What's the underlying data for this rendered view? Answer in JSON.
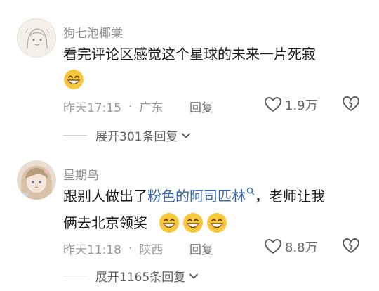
{
  "comments": [
    {
      "username": "狗七泡椰棠",
      "text": "看完评论区感觉这个星球的未来一片死寂",
      "emoji_count": 1,
      "time": "昨天17:15",
      "location": "广东",
      "reply_label": "回复",
      "likes": "1.9万",
      "expand_label": "展开301条回复"
    },
    {
      "username": "星期鸟",
      "text_before_link": "跟别人做出了",
      "link_text": "粉色的阿司匹林",
      "text_after_link": "，老师让我",
      "text_line2": "俩去北京领奖",
      "emoji_count": 3,
      "time": "昨天11:18",
      "location": "陕西",
      "reply_label": "回复",
      "likes": "8.8万",
      "expand_label": "展开1165条回复"
    }
  ],
  "separator": "·",
  "colors": {
    "link": "#3c69a8",
    "meta": "#9a9a9a",
    "emoji_face": "#f7c83b"
  },
  "icons": [
    "avatar",
    "grin-emoji",
    "heart-icon",
    "broken-heart-icon",
    "chevron-down-icon",
    "search-icon"
  ]
}
